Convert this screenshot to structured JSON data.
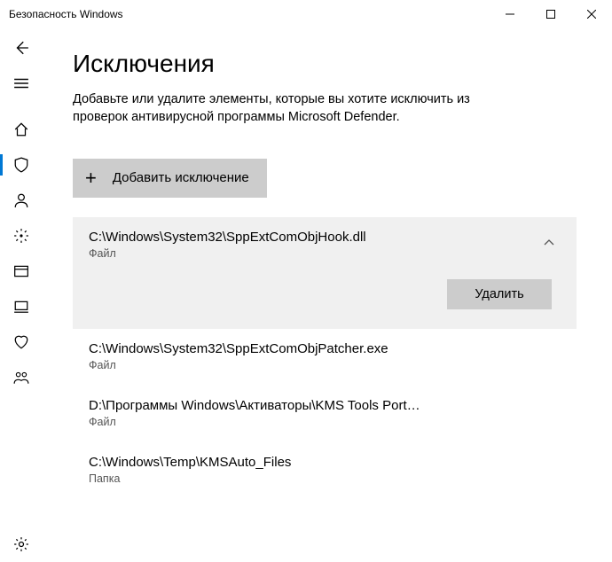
{
  "window": {
    "title": "Безопасность Windows"
  },
  "page": {
    "heading": "Исключения",
    "description": "Добавьте или удалите элементы, которые вы хотите исключить из проверок антивирусной программы Microsoft Defender."
  },
  "add_button": {
    "label": "Добавить исключение"
  },
  "remove_button": {
    "label": "Удалить"
  },
  "exclusions": [
    {
      "path": "C:\\Windows\\System32\\SppExtComObjHook.dll",
      "type": "Файл",
      "expanded": true
    },
    {
      "path": "C:\\Windows\\System32\\SppExtComObjPatcher.exe",
      "type": "Файл",
      "expanded": false
    },
    {
      "path": "D:\\Программы Windows\\Активаторы\\KMS Tools Portable...",
      "type": "Файл",
      "expanded": false
    },
    {
      "path": "C:\\Windows\\Temp\\KMSAuto_Files",
      "type": "Папка",
      "expanded": false
    }
  ],
  "nav": {
    "items": [
      {
        "icon": "back",
        "selected": false
      },
      {
        "icon": "menu",
        "selected": false
      },
      {
        "icon": "home",
        "selected": false
      },
      {
        "icon": "shield",
        "selected": true
      },
      {
        "icon": "account",
        "selected": false
      },
      {
        "icon": "firewall",
        "selected": false
      },
      {
        "icon": "app-browser",
        "selected": false
      },
      {
        "icon": "device",
        "selected": false
      },
      {
        "icon": "health",
        "selected": false
      },
      {
        "icon": "family",
        "selected": false
      }
    ],
    "footer": {
      "icon": "settings"
    }
  }
}
